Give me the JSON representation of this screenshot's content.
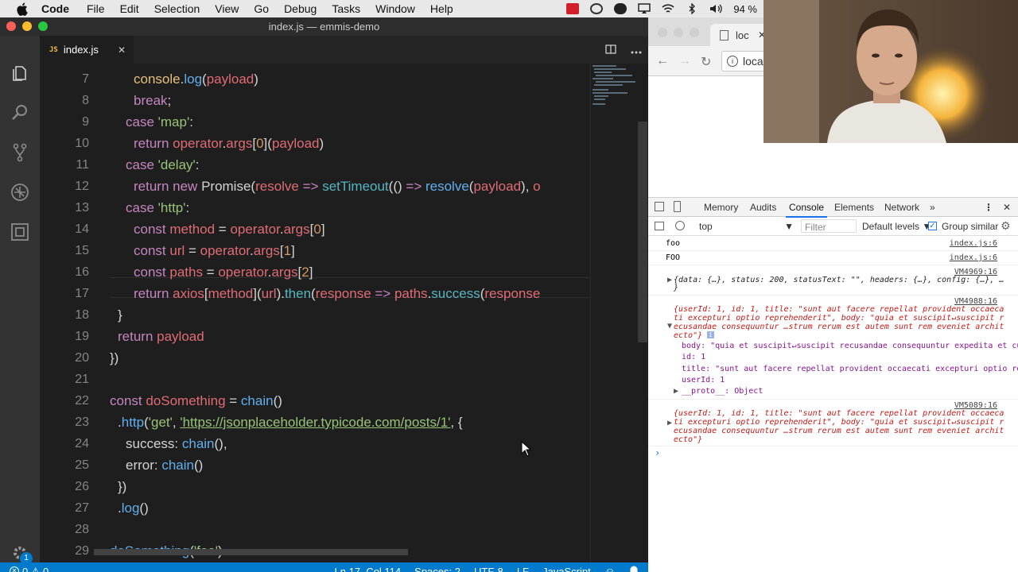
{
  "menubar": {
    "items": [
      "Code",
      "File",
      "Edit",
      "Selection",
      "View",
      "Go",
      "Debug",
      "Tasks",
      "Window",
      "Help"
    ],
    "battery": "94 %"
  },
  "window": {
    "title": "index.js — emmis-demo"
  },
  "tab": {
    "icon_label": "JS",
    "name": "index.js",
    "close": "✕"
  },
  "editor": {
    "lines": [
      {
        "n": "7",
        "x": 30,
        "tokens": [
          [
            "fy",
            "console"
          ],
          [
            "p",
            "."
          ],
          [
            "b",
            "log"
          ],
          [
            "p",
            "("
          ],
          [
            "v",
            "payload"
          ],
          [
            "p",
            ")"
          ]
        ]
      },
      {
        "n": "8",
        "x": 30,
        "tokens": [
          [
            "k",
            "break"
          ],
          [
            "p",
            ";"
          ]
        ]
      },
      {
        "n": "9",
        "x": 20,
        "tokens": [
          [
            "k",
            "case "
          ],
          [
            "s",
            "'map'"
          ],
          [
            "p",
            ":"
          ]
        ]
      },
      {
        "n": "10",
        "x": 30,
        "tokens": [
          [
            "k",
            "return "
          ],
          [
            "v",
            "operator"
          ],
          [
            "p",
            "."
          ],
          [
            "v",
            "args"
          ],
          [
            "p",
            "["
          ],
          [
            "n",
            "0"
          ],
          [
            "p",
            "]("
          ],
          [
            "v",
            "payload"
          ],
          [
            "p",
            ")"
          ]
        ]
      },
      {
        "n": "11",
        "x": 20,
        "tokens": [
          [
            "k",
            "case "
          ],
          [
            "s",
            "'delay'"
          ],
          [
            "p",
            ":"
          ]
        ]
      },
      {
        "n": "12",
        "x": 30,
        "tokens": [
          [
            "k",
            "return "
          ],
          [
            "k",
            "new "
          ],
          [
            "p",
            "Promise("
          ],
          [
            "v",
            "resolve"
          ],
          [
            "k",
            " => "
          ],
          [
            "f",
            "setTimeout"
          ],
          [
            "p",
            "(() "
          ],
          [
            "k",
            "=> "
          ],
          [
            "b",
            "resolve"
          ],
          [
            "p",
            "("
          ],
          [
            "v",
            "payload"
          ],
          [
            "p",
            "), "
          ],
          [
            "v",
            "o"
          ]
        ]
      },
      {
        "n": "13",
        "x": 20,
        "tokens": [
          [
            "k",
            "case "
          ],
          [
            "s",
            "'http'"
          ],
          [
            "p",
            ":"
          ]
        ]
      },
      {
        "n": "14",
        "x": 30,
        "tokens": [
          [
            "k",
            "const "
          ],
          [
            "v",
            "method"
          ],
          [
            "p",
            " = "
          ],
          [
            "v",
            "operator"
          ],
          [
            "p",
            "."
          ],
          [
            "v",
            "args"
          ],
          [
            "p",
            "["
          ],
          [
            "n",
            "0"
          ],
          [
            "p",
            "]"
          ]
        ]
      },
      {
        "n": "15",
        "x": 30,
        "tokens": [
          [
            "k",
            "const "
          ],
          [
            "v",
            "url"
          ],
          [
            "p",
            " = "
          ],
          [
            "v",
            "operator"
          ],
          [
            "p",
            "."
          ],
          [
            "v",
            "args"
          ],
          [
            "p",
            "["
          ],
          [
            "n",
            "1"
          ],
          [
            "p",
            "]"
          ]
        ]
      },
      {
        "n": "16",
        "x": 30,
        "tokens": [
          [
            "k",
            "const "
          ],
          [
            "v",
            "paths"
          ],
          [
            "p",
            " = "
          ],
          [
            "v",
            "operator"
          ],
          [
            "p",
            "."
          ],
          [
            "v",
            "args"
          ],
          [
            "p",
            "["
          ],
          [
            "n",
            "2"
          ],
          [
            "p",
            "]"
          ]
        ]
      },
      {
        "n": "17",
        "x": 30,
        "tokens": [
          [
            "k",
            "return "
          ],
          [
            "v",
            "axios"
          ],
          [
            "p",
            "["
          ],
          [
            "v",
            "method"
          ],
          [
            "p",
            "]("
          ],
          [
            "v",
            "url"
          ],
          [
            "p",
            ")."
          ],
          [
            "f",
            "then"
          ],
          [
            "p",
            "("
          ],
          [
            "v",
            "response"
          ],
          [
            "k",
            " => "
          ],
          [
            "v",
            "paths"
          ],
          [
            "p",
            "."
          ],
          [
            "f",
            "success"
          ],
          [
            "p",
            "("
          ],
          [
            "v",
            "response"
          ]
        ]
      },
      {
        "n": "18",
        "x": 10,
        "tokens": [
          [
            "p",
            "}"
          ]
        ]
      },
      {
        "n": "19",
        "x": 10,
        "tokens": [
          [
            "k",
            "return "
          ],
          [
            "v",
            "payload"
          ]
        ]
      },
      {
        "n": "20",
        "x": 0,
        "tokens": [
          [
            "p",
            "})"
          ]
        ]
      },
      {
        "n": "21",
        "x": 0,
        "tokens": []
      },
      {
        "n": "22",
        "x": 0,
        "tokens": [
          [
            "k",
            "const "
          ],
          [
            "v",
            "doSomething"
          ],
          [
            "p",
            " = "
          ],
          [
            "b",
            "chain"
          ],
          [
            "p",
            "()"
          ]
        ]
      },
      {
        "n": "23",
        "x": 10,
        "tokens": [
          [
            "p",
            "."
          ],
          [
            "b",
            "http"
          ],
          [
            "p",
            "("
          ],
          [
            "s",
            "'get'"
          ],
          [
            "p",
            ", "
          ],
          [
            "s",
            "'https://jsonplaceholder.typicode.com/posts/1'"
          ],
          [
            "p",
            ", {"
          ]
        ]
      },
      {
        "n": "24",
        "x": 20,
        "tokens": [
          [
            "p",
            "success: "
          ],
          [
            "b",
            "chain"
          ],
          [
            "p",
            "(),"
          ]
        ]
      },
      {
        "n": "25",
        "x": 20,
        "tokens": [
          [
            "p",
            "error: "
          ],
          [
            "b",
            "chain"
          ],
          [
            "p",
            "()"
          ]
        ]
      },
      {
        "n": "26",
        "x": 10,
        "tokens": [
          [
            "p",
            "})"
          ]
        ]
      },
      {
        "n": "27",
        "x": 10,
        "tokens": [
          [
            "p",
            "."
          ],
          [
            "b",
            "log"
          ],
          [
            "p",
            "()"
          ]
        ]
      },
      {
        "n": "28",
        "x": 0,
        "tokens": []
      },
      {
        "n": "29",
        "x": 0,
        "tokens": [
          [
            "b",
            "doSomething"
          ],
          [
            "p",
            "("
          ],
          [
            "s",
            "'foo'"
          ],
          [
            "p",
            ")"
          ]
        ]
      }
    ]
  },
  "status": {
    "errors": "0",
    "warnings": "0",
    "position": "Ln 17, Col 114",
    "spaces": "Spaces: 2",
    "encoding": "UTF-8",
    "eol": "LF",
    "language": "JavaScript",
    "notifications": "1"
  },
  "browser": {
    "tab_title": "loc",
    "url": "loca"
  },
  "devtools": {
    "tabs": [
      "Memory",
      "Audits",
      "Console",
      "Elements",
      "Network"
    ],
    "active_tab": "Console",
    "context": "top",
    "filter_placeholder": "Filter",
    "levels": "Default levels ▼",
    "group_similar": "Group similar",
    "console": {
      "line1": {
        "text": "foo",
        "src": "index.js:6"
      },
      "line2": {
        "text": "FOO",
        "src": "index.js:6"
      },
      "line3": {
        "src": "VM4969:16",
        "text": "{data: {…}, status: 200, statusText: \"\", headers: {…}, config: {…}, …",
        "close": "}"
      },
      "line4": {
        "src": "VM4988:16",
        "l1": "{userId: 1, id: 1, title: \"sunt aut facere repellat provident occaeca",
        "l2": "ti excepturi optio reprehenderit\", body: \"quia et suscipit↵suscipit r",
        "l3": "ecusandae consequuntur …strum rerum est autem sunt rem eveniet archit",
        "l4": "ecto\"}",
        "body": "body: \"quia et suscipit↵suscipit recusandae consequuntur expedita et cu",
        "id": "id: 1",
        "title": "title: \"sunt aut facere repellat provident occaecati excepturi optio re",
        "userId": "userId: 1",
        "proto": "__proto__: Object"
      },
      "line5": {
        "src": "VM5089:16",
        "l1": "{userId: 1, id: 1, title: \"sunt aut facere repellat provident occaeca",
        "l2": "ti excepturi optio reprehenderit\", body: \"quia et suscipit↵suscipit r",
        "l3": "ecusandae consequuntur …strum rerum est autem sunt rem eveniet archit",
        "l4": "ecto\"}"
      },
      "prompt": "›"
    }
  },
  "colors": {
    "accent": "#007acc",
    "activity": "#333333",
    "editor_bg": "#1e1e1e"
  }
}
